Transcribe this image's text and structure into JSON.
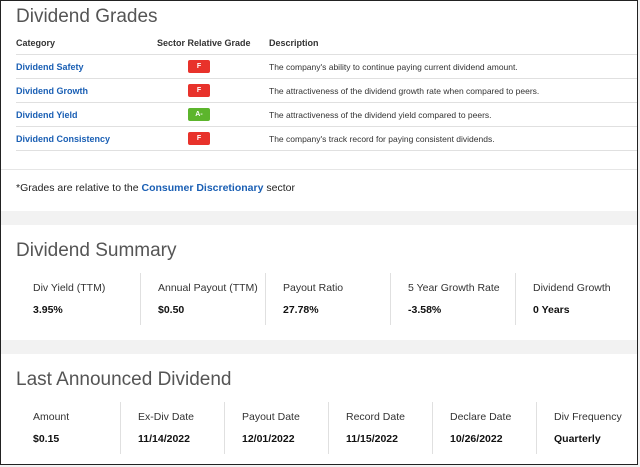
{
  "grades": {
    "title": "Dividend Grades",
    "columns": [
      "Category",
      "Sector Relative Grade",
      "Description"
    ],
    "rows": [
      {
        "category": "Dividend Safety",
        "grade": "F",
        "description": "The company's ability to continue paying current dividend amount."
      },
      {
        "category": "Dividend Growth",
        "grade": "F",
        "description": "The attractiveness of the dividend growth rate when compared to peers."
      },
      {
        "category": "Dividend Yield",
        "grade": "A-",
        "description": "The attractiveness of the dividend yield compared to peers."
      },
      {
        "category": "Dividend Consistency",
        "grade": "F",
        "description": "The company's track record for paying consistent dividends."
      }
    ],
    "footnote_prefix": "*Grades are relative to the ",
    "footnote_link": "Consumer Discretionary",
    "footnote_suffix": " sector",
    "colors": {
      "fail": "#e8322b",
      "good": "#5cb52c",
      "link": "#1a5fb4"
    }
  },
  "summary": {
    "title": "Dividend Summary",
    "stats": [
      {
        "label": "Div Yield (TTM)",
        "value": "3.95%"
      },
      {
        "label": "Annual Payout (TTM)",
        "value": "$0.50"
      },
      {
        "label": "Payout Ratio",
        "value": "27.78%"
      },
      {
        "label": "5 Year Growth Rate",
        "value": "-3.58%"
      },
      {
        "label": "Dividend Growth",
        "value": "0 Years"
      }
    ]
  },
  "last_dividend": {
    "title": "Last Announced Dividend",
    "stats": [
      {
        "label": "Amount",
        "value": "$0.15"
      },
      {
        "label": "Ex-Div Date",
        "value": "11/14/2022"
      },
      {
        "label": "Payout Date",
        "value": "12/01/2022"
      },
      {
        "label": "Record Date",
        "value": "11/15/2022"
      },
      {
        "label": "Declare Date",
        "value": "10/26/2022"
      },
      {
        "label": "Div Frequency",
        "value": "Quarterly"
      }
    ]
  }
}
